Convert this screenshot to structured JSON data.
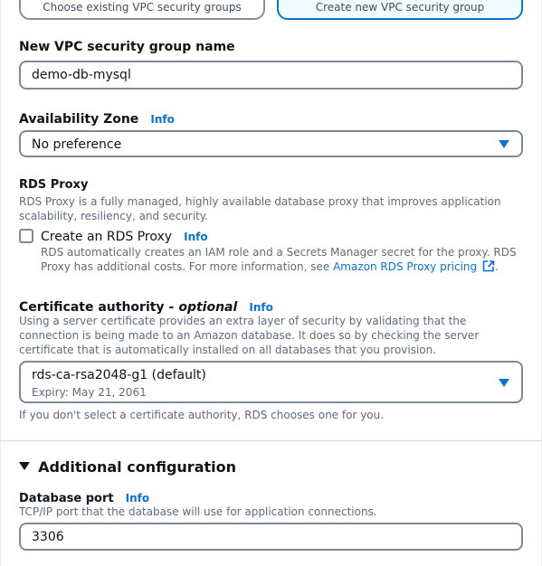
{
  "vpc_sg_tiles": {
    "existing_label": "Choose existing VPC security groups",
    "create_label": "Create new VPC security group"
  },
  "sg_name": {
    "label": "New VPC security group name",
    "value": "demo-db-mysql"
  },
  "availability_zone": {
    "label": "Availability Zone",
    "info": "Info",
    "value": "No preference"
  },
  "rds_proxy": {
    "heading": "RDS Proxy",
    "description": "RDS Proxy is a fully managed, highly available database proxy that improves application scalability, resiliency, and security.",
    "checkbox_label": "Create an RDS Proxy",
    "info": "Info",
    "checkbox_desc": "RDS automatically creates an IAM role and a Secrets Manager secret for the proxy. RDS Proxy has additional costs. For more information, see",
    "link_text": "Amazon RDS Proxy pricing",
    "link_suffix": ".",
    "checked": false
  },
  "certificate_authority": {
    "label": "Certificate authority -",
    "optional": "optional",
    "info": "Info",
    "description": "Using a server certificate provides an extra layer of security by validating that the connection is being made to an Amazon database. It does so by checking the server certificate that is automatically installed on all databases that you provision.",
    "value": "rds-ca-rsa2048-g1 (default)",
    "expiry": "Expiry: May 21, 2061",
    "hint": "If you don't select a certificate authority, RDS chooses one for you."
  },
  "additional_config": {
    "heading": "Additional configuration",
    "expanded": true
  },
  "database_port": {
    "label": "Database port",
    "info": "Info",
    "description": "TCP/IP port that the database will use for application connections.",
    "value": "3306"
  },
  "colors": {
    "accent": "#0972d3",
    "text": "#0f141a",
    "secondary": "#5f6b7a",
    "border": "#7d8998"
  }
}
